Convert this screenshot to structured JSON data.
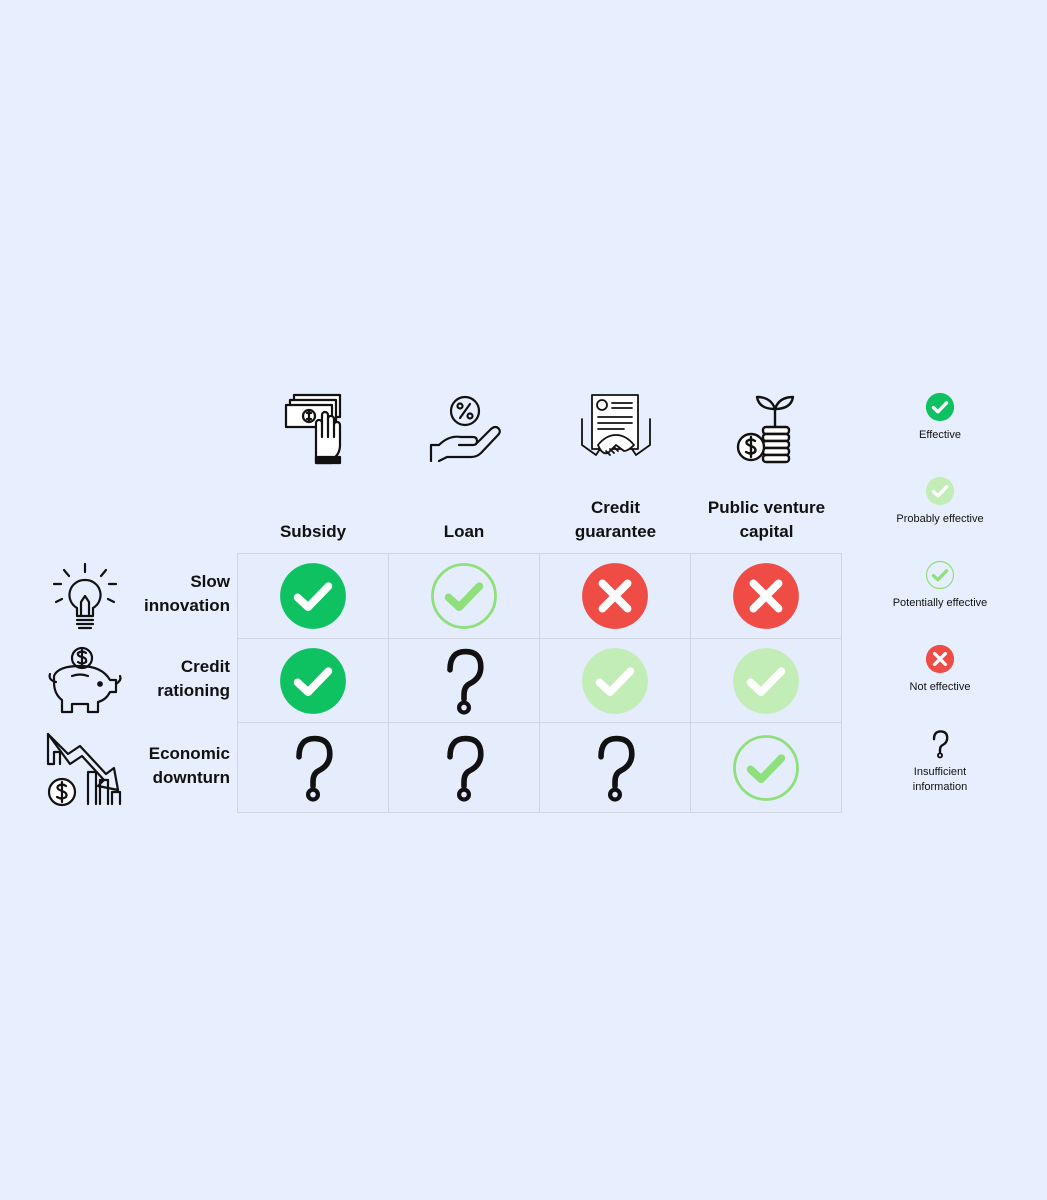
{
  "columns": [
    {
      "label": "Subsidy",
      "icon": "cash-hand-icon"
    },
    {
      "label": "Loan",
      "icon": "percent-hand-icon"
    },
    {
      "label": "Credit guarantee",
      "icon": "contract-handshake-icon"
    },
    {
      "label": "Public venture capital",
      "icon": "coin-sprout-icon"
    }
  ],
  "rows": [
    {
      "label": "Slow innovation",
      "icon": "lightbulb-icon",
      "cells": [
        "effective",
        "potentially_effective",
        "not_effective",
        "not_effective"
      ]
    },
    {
      "label": "Credit rationing",
      "icon": "piggy-bank-icon",
      "cells": [
        "effective",
        "insufficient",
        "probably_effective",
        "probably_effective"
      ]
    },
    {
      "label": "Economic downturn",
      "icon": "downturn-chart-icon",
      "cells": [
        "insufficient",
        "insufficient",
        "insufficient",
        "potentially_effective"
      ]
    }
  ],
  "legend": [
    {
      "status": "effective",
      "label": "Effective"
    },
    {
      "status": "probably_effective",
      "label": "Probably effective"
    },
    {
      "status": "potentially_effective",
      "label": "Potentially effective"
    },
    {
      "status": "not_effective",
      "label": "Not effective"
    },
    {
      "status": "insufficient",
      "label": "Insufficient information"
    }
  ],
  "colors": {
    "background": "#e7efff",
    "effective": "#0fc261",
    "probably_effective": "#c2edb6",
    "potentially_effective": "#8fe07d",
    "not_effective": "#ef4c45",
    "insufficient": "#111111",
    "cell_background": "#e5ecfb",
    "cell_border": "#cfd6e2"
  }
}
